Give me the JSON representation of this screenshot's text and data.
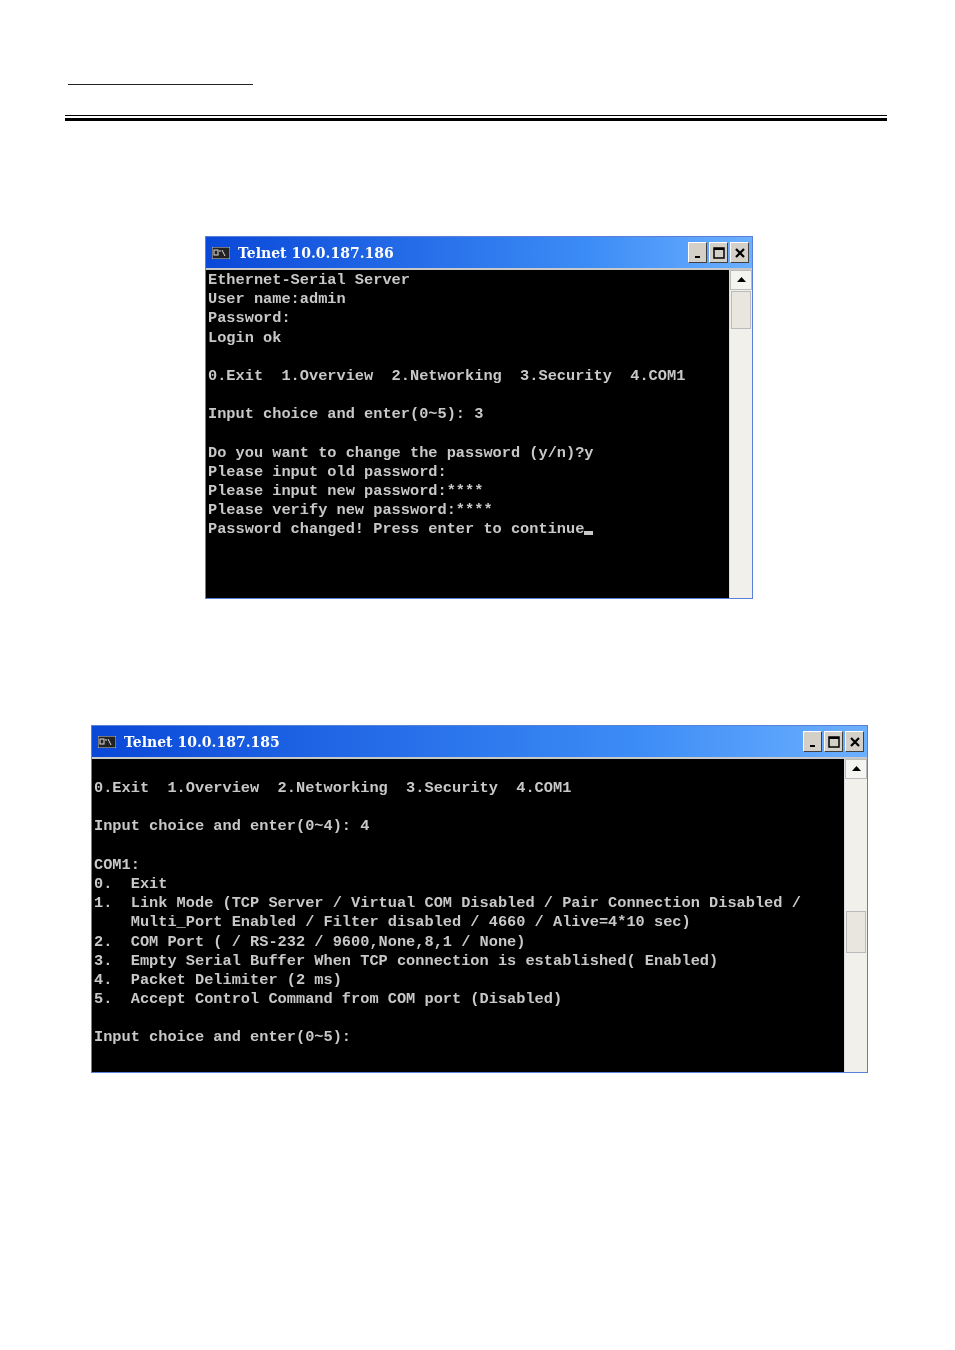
{
  "windows": [
    {
      "title": "Telnet 10.0.187.186",
      "cursor": true,
      "blocks": [
        [
          "Ethernet-Serial Server",
          "User name:admin",
          "Password:",
          "Login ok"
        ],
        [
          "0.Exit  1.Overview  2.Networking  3.Security  4.COM1"
        ],
        [
          "Input choice and enter(0~5): 3"
        ],
        [
          "Do you want to change the password (y/n)?y",
          "Please input old password:",
          "Please input new password:****",
          "Please verify new password:****",
          "Password changed! Press enter to continue"
        ]
      ]
    },
    {
      "title": "Telnet 10.0.187.185",
      "blocks": [
        [
          "0.Exit  1.Overview  2.Networking  3.Security  4.COM1"
        ],
        [
          "Input choice and enter(0~4): 4"
        ],
        [
          "COM1:",
          "0.  Exit",
          "1.  Link Mode (TCP Server / Virtual COM Disabled / Pair Connection Disabled /",
          "    Multi_Port Enabled / Filter disabled / 4660 / Alive=4*10 sec)",
          "2.  COM Port ( / RS-232 / 9600,None,8,1 / None)",
          "3.  Empty Serial Buffer When TCP connection is established( Enabled)",
          "4.  Packet Delimiter (2 ms)",
          "5.  Accept Control Command from COM port (Disabled)"
        ],
        [
          "Input choice and enter(0~5):"
        ]
      ]
    }
  ]
}
